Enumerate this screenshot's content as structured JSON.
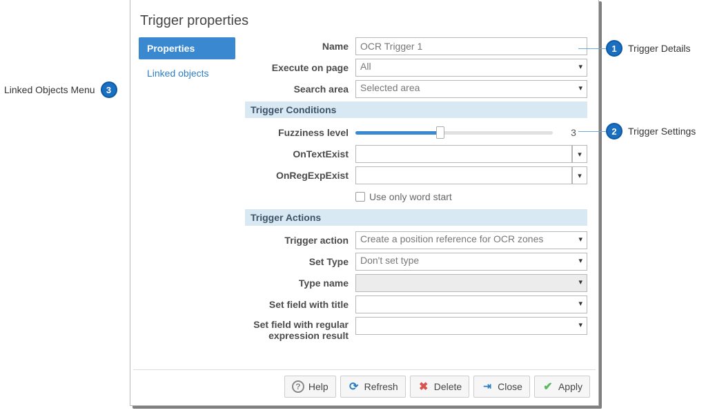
{
  "dialog_title": "Trigger properties",
  "sidebar": {
    "tabs": [
      {
        "label": "Properties",
        "active": true
      },
      {
        "label": "Linked objects",
        "active": false
      }
    ]
  },
  "details": {
    "name_label": "Name",
    "name_value": "OCR Trigger 1",
    "execute_label": "Execute on page",
    "execute_value": "All",
    "search_label": "Search area",
    "search_value": "Selected area"
  },
  "conditions": {
    "header": "Trigger Conditions",
    "fuzziness_label": "Fuzziness level",
    "fuzziness_value": "3",
    "ontextexist_label": "OnTextExist",
    "ontextexist_value": "",
    "onregexp_label": "OnRegExpExist",
    "onregexp_value": "",
    "wordstart_label": "Use only word start"
  },
  "actions": {
    "header": "Trigger Actions",
    "trigger_action_label": "Trigger action",
    "trigger_action_value": "Create a position reference for OCR zones",
    "set_type_label": "Set Type",
    "set_type_value": "Don't set type",
    "type_name_label": "Type name",
    "set_field_title_label": "Set field with title",
    "set_field_regex_label": "Set field with regular expression result"
  },
  "footer": {
    "help": "Help",
    "refresh": "Refresh",
    "delete": "Delete",
    "close": "Close",
    "apply": "Apply"
  },
  "callouts": {
    "c1": {
      "num": "1",
      "text": "Trigger Details"
    },
    "c2": {
      "num": "2",
      "text": "Trigger Settings"
    },
    "c3": {
      "num": "3",
      "text": "Linked Objects Menu"
    }
  }
}
